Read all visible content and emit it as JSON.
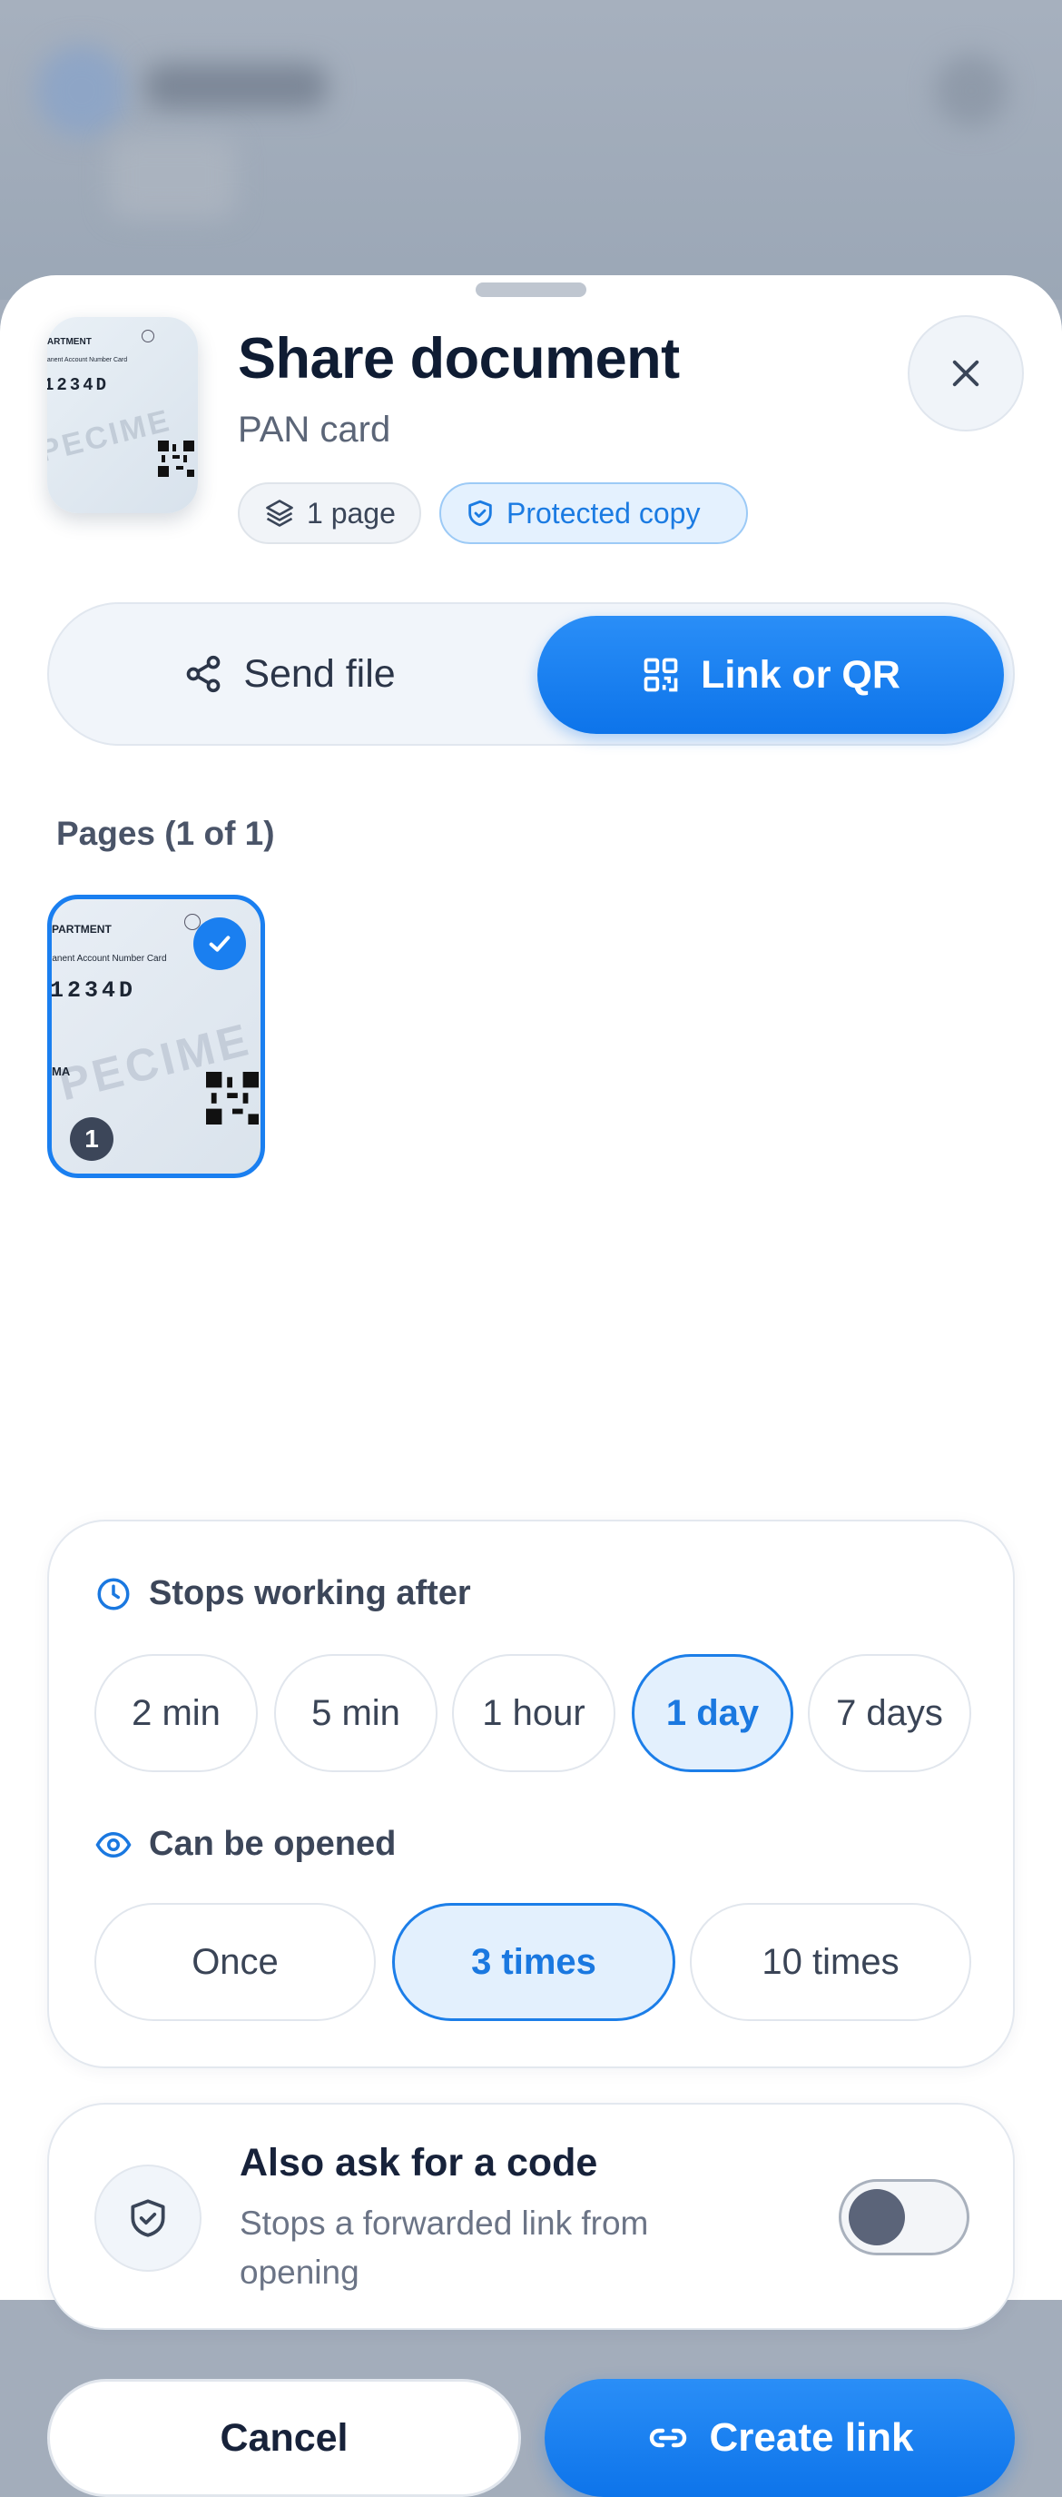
{
  "header": {
    "title": "Share document",
    "subtitle": "PAN card",
    "pages_chip": "1 page",
    "protected_chip": "Protected copy"
  },
  "document_preview": {
    "line1": "PARTMENT",
    "line2": "manent Account Number Card",
    "number": "1234D",
    "watermark": "PECIME",
    "line4": "MA"
  },
  "mode_toggle": {
    "send_file": "Send file",
    "link_or_qr": "Link or QR",
    "selected": "Link or QR"
  },
  "pages": {
    "label": "Pages (1 of 1)",
    "items": [
      {
        "number": "1",
        "selected": true
      }
    ]
  },
  "expiry": {
    "title": "Stops working after",
    "options": [
      "2 min",
      "5 min",
      "1 hour",
      "1 day",
      "7 days"
    ],
    "selected": "1 day"
  },
  "open_limit": {
    "title": "Can be opened",
    "options": [
      "Once",
      "3 times",
      "10 times"
    ],
    "selected": "3 times"
  },
  "passcode": {
    "title": "Also ask for a code",
    "description": "Stops a forwarded link from opening",
    "enabled": false
  },
  "actions": {
    "cancel": "Cancel",
    "create": "Create link"
  },
  "colors": {
    "accent": "#0d74ea",
    "accent_light": "#e3f0fd",
    "text_dark": "#0f1c33",
    "text_muted": "#6b7486"
  },
  "icons": {
    "close": "close-icon",
    "layers": "layers-icon",
    "shield": "shield-check-icon",
    "share": "share-icon",
    "qr": "qr-code-icon",
    "clock": "clock-icon",
    "eye": "eye-icon",
    "link": "link-icon",
    "check": "check-icon"
  }
}
